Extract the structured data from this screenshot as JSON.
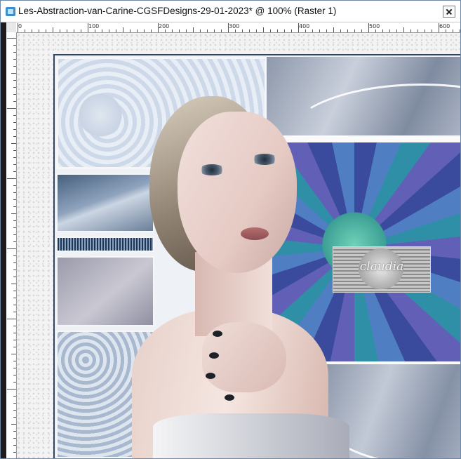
{
  "window": {
    "title": "Les-Abstraction-van-Carine-CGSFDesigns-29-01-2023* @ 100% (Raster 1)",
    "app_icon": "paint-app-icon",
    "close_icon": "close-icon"
  },
  "ruler": {
    "horizontal_labels": [
      "0",
      "100",
      "200",
      "300",
      "400",
      "500",
      "600"
    ]
  },
  "canvas": {
    "zoom": "100%",
    "layer": "Raster 1",
    "watermark_text": "claudia"
  },
  "colors": {
    "frame_border": "#2f4660",
    "accent_blue": "#3a4a9c",
    "teal": "#3c9f94"
  }
}
